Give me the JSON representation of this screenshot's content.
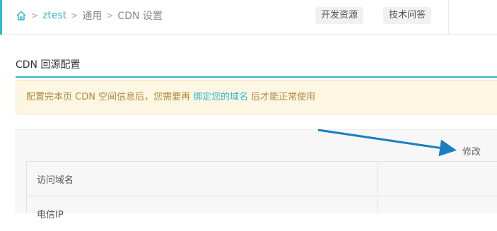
{
  "breadcrumb": {
    "home_icon": "home-icon",
    "items": [
      "ztest",
      "通用",
      "CDN 设置"
    ],
    "separator": ">"
  },
  "header_buttons": {
    "dev_resources": "开发资源",
    "tech_support": "技术问答"
  },
  "section": {
    "title": "CDN 回源配置"
  },
  "notice": {
    "before": "配置完本页 CDN 空间信息后，您需要再",
    "link": "绑定您的域名",
    "after": "后才能正常使用"
  },
  "panel": {
    "edit_label": "修改",
    "rows": [
      "访问域名",
      "电信IP"
    ]
  },
  "colors": {
    "accent": "#35b5ce",
    "notice_bg": "#fdf6e2",
    "notice_text": "#b08a3e",
    "arrow": "#1a7fc0"
  }
}
